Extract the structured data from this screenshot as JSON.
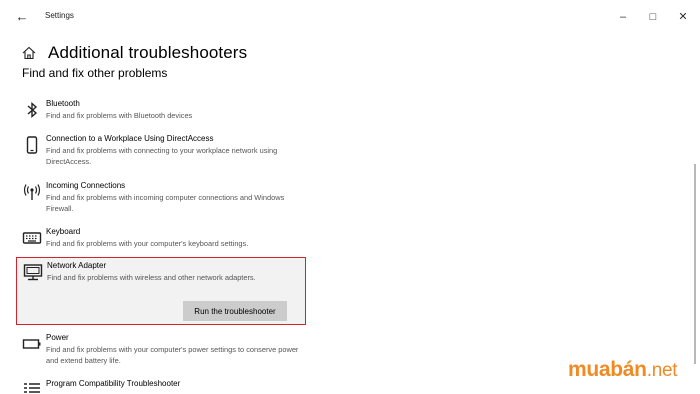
{
  "window": {
    "app_title": "Settings",
    "back_icon": "back-arrow-icon",
    "controls": [
      "minimize-icon",
      "maximize-icon",
      "close-icon"
    ]
  },
  "page": {
    "title": "Additional troubleshooters",
    "section_title": "Find and fix other problems",
    "home_icon": "home-icon"
  },
  "troubleshooters": [
    {
      "name": "Bluetooth",
      "desc": "Find and fix problems with Bluetooth devices",
      "icon": "bluetooth-icon"
    },
    {
      "name": "Connection to a Workplace Using DirectAccess",
      "desc": "Find and fix problems with connecting to your workplace network using DirectAccess.",
      "icon": "phone-icon"
    },
    {
      "name": "Incoming Connections",
      "desc": "Find and fix problems with incoming computer connections and Windows Firewall.",
      "icon": "antenna-icon"
    },
    {
      "name": "Keyboard",
      "desc": "Find and fix problems with your computer's keyboard settings.",
      "icon": "keyboard-icon"
    },
    {
      "name": "Network Adapter",
      "desc": "Find and fix problems with wireless and other network adapters.",
      "icon": "network-adapter-icon",
      "expanded": true,
      "button_label": "Run the troubleshooter",
      "highlight_color": "#d1242f"
    },
    {
      "name": "Power",
      "desc": "Find and fix problems with your computer's power settings to conserve power and extend battery life.",
      "icon": "battery-icon"
    },
    {
      "name": "Program Compatibility Troubleshooter",
      "desc": "",
      "icon": "list-icon"
    }
  ],
  "watermark": {
    "main": "muabán",
    "suffix": ".net",
    "color": "#f08a24"
  }
}
